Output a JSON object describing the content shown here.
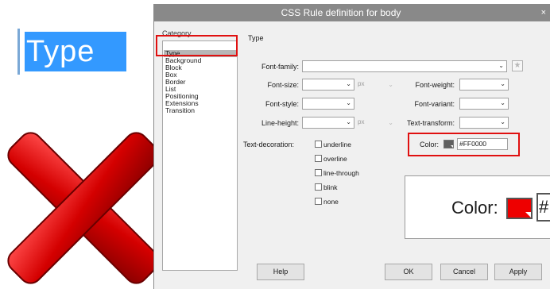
{
  "zoom_label": "Type",
  "dialog": {
    "title": "CSS Rule definition for body",
    "close_glyph": "×",
    "category_header": "Category",
    "categories": [
      "Type",
      "Background",
      "Block",
      "Box",
      "Border",
      "List",
      "Positioning",
      "Extensions",
      "Transition"
    ],
    "selected_category": "Type",
    "section_header": "Type",
    "fields": {
      "font_family": {
        "label": "Font-family:",
        "value": ""
      },
      "font_size": {
        "label": "Font-size:",
        "value": "",
        "unit": "px"
      },
      "font_weight": {
        "label": "Font-weight:",
        "value": ""
      },
      "font_style": {
        "label": "Font-style:",
        "value": ""
      },
      "font_variant": {
        "label": "Font-variant:",
        "value": ""
      },
      "line_height": {
        "label": "Line-height:",
        "value": "",
        "unit": "px"
      },
      "text_transform": {
        "label": "Text-transform:",
        "value": ""
      },
      "color": {
        "label": "Color:",
        "value": "#FF0000"
      }
    },
    "text_decoration": {
      "label": "Text-decoration:",
      "options": [
        "underline",
        "overline",
        "line-through",
        "blink",
        "none"
      ]
    },
    "buttons": {
      "help": "Help",
      "ok": "OK",
      "cancel": "Cancel",
      "apply": "Apply"
    }
  },
  "zoom_color": {
    "label": "Color:",
    "hex_fragment": "#"
  },
  "colors": {
    "highlight_red": "#e01010",
    "selection_blue": "#3399ff",
    "swatch_red": "#ee0000"
  }
}
